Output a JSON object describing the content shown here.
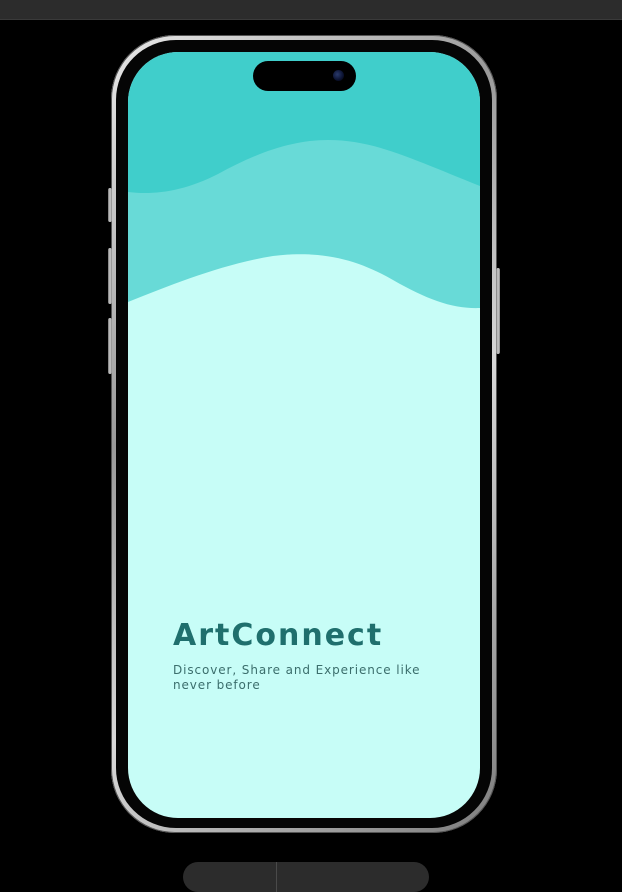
{
  "app": {
    "title": "ArtConnect",
    "subtitle": "Discover, Share and Experience like never before"
  },
  "colors": {
    "background": "#c7fdf7",
    "wave_top": "#40cecb",
    "wave_middle": "#68dad7",
    "title_color": "#1f6f6d",
    "subtitle_color": "#3b6e6c",
    "canvas": "#000000"
  },
  "icons": {
    "camera": "front-camera-icon"
  }
}
